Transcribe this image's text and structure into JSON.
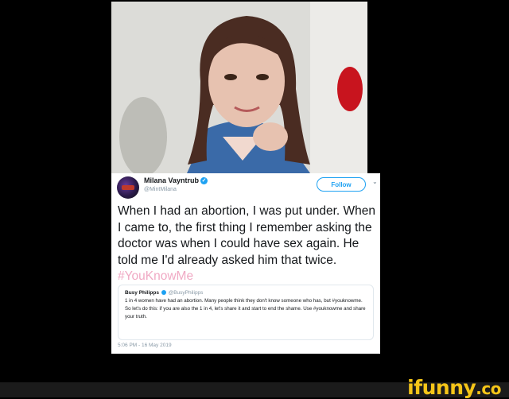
{
  "tweet": {
    "author_name": "Milana Vayntrub",
    "author_handle": "@MintMilana",
    "follow_label": "Follow",
    "text": "When I had an abortion, I was put under. When I came to, the first thing I remember asking the doctor was when I could have sex again. He told me I'd already asked him that twice.",
    "hashtag": "#YouKnowMe",
    "timestamp": "5:06 PM - 16 May 2019"
  },
  "quoted_tweet": {
    "author_name": "Busy Philipps",
    "author_handle": "@BusyPhilipps",
    "text": "1 in 4 women have had an abortion. Many people think they don't know someone who has, but #youknowme. So let's do this: if you are also the 1 in 4, let's share it and start to end the shame. Use #youknowme and share your truth."
  },
  "brand": {
    "name": "ifunny",
    "suffix": ".co"
  },
  "colors": {
    "twitter_blue": "#1da1f2",
    "hashtag_pink": "#f0a9c4",
    "brand_yellow": "#f5c518",
    "background": "#000000"
  }
}
